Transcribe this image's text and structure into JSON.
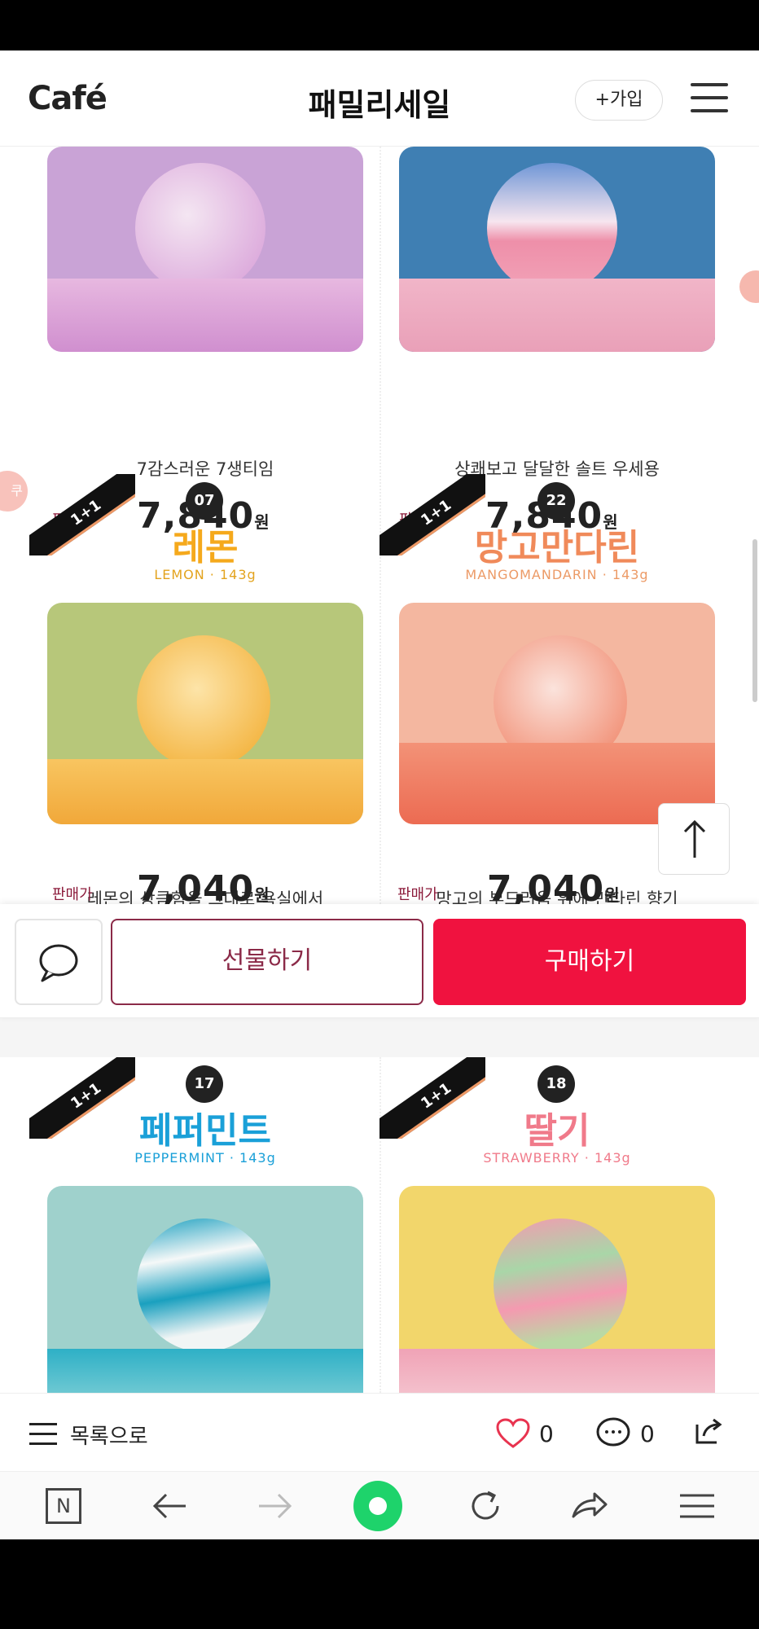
{
  "header": {
    "logo": "Café",
    "title": "패밀리세일",
    "join_label": "+가입"
  },
  "products_top": [
    {
      "desc": "7감스러운 7생티임",
      "price_label": "판매가",
      "price": "7,840",
      "currency": "원"
    },
    {
      "desc": "상쾌보고 달달한 솔트 우세용",
      "price_label": "판매가",
      "price": "7,840",
      "currency": "원"
    }
  ],
  "products_mid": [
    {
      "ribbon": "1+1",
      "number": "07",
      "name": "레몬",
      "eng": "LEMON · 143g",
      "desc": "레몬의 상큼함을 그대로 욕실에서",
      "price_label": "판매가",
      "price": "7,040",
      "currency": "원",
      "name_color": "#f5a91c"
    },
    {
      "ribbon": "1+1",
      "number": "22",
      "name": "망고만다린",
      "eng": "MANGOMANDARIN · 143g",
      "desc": "망고의 부드러움 위에 만다린 향기",
      "price_label": "판매가",
      "price": "7,040",
      "currency": "원",
      "name_color": "#f08a5a"
    }
  ],
  "products_bottom": [
    {
      "ribbon": "1+1",
      "number": "17",
      "name": "페퍼민트",
      "eng": "PEPPERMINT · 143g",
      "name_color": "#1aa0d8"
    },
    {
      "ribbon": "1+1",
      "number": "18",
      "name": "딸기",
      "eng": "STRAWBERRY · 143g",
      "name_color": "#f07a8a"
    }
  ],
  "actions": {
    "gift_label": "선물하기",
    "buy_label": "구매하기"
  },
  "side_badge": "쿠",
  "list_bar": {
    "list_label": "목록으로",
    "like_count": "0",
    "comment_count": "0"
  },
  "browser_bar": {
    "home_label": "N"
  },
  "colors": {
    "buy": "#f0123f",
    "gift_border": "#8b2a48",
    "browser_accent": "#1ed36b"
  },
  "icons": [
    "chat-icon",
    "arrow-up-icon",
    "hamburger-icon",
    "list-icon",
    "heart-icon",
    "comment-icon",
    "share-icon",
    "back-arrow-icon",
    "forward-arrow-icon",
    "refresh-icon",
    "browser-share-icon",
    "menu-icon"
  ]
}
